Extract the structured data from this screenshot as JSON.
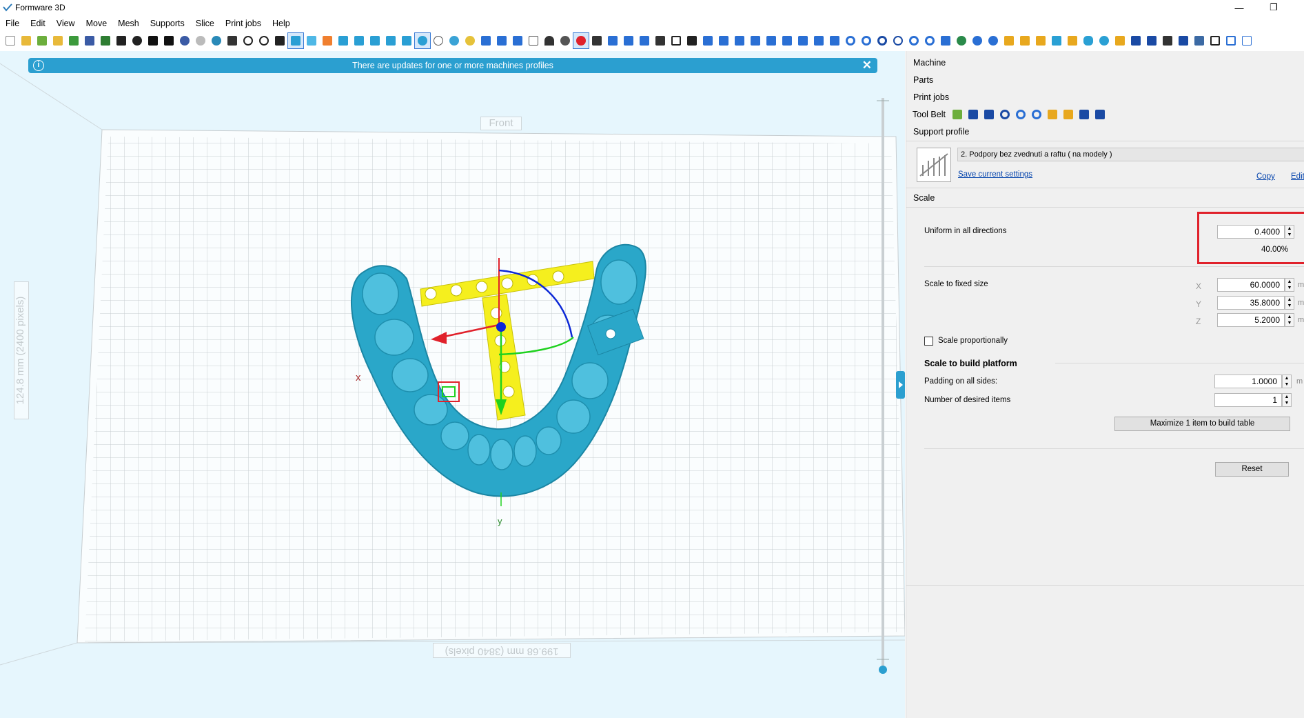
{
  "window": {
    "title": "Formware 3D",
    "minimize": "—",
    "restore": "❐"
  },
  "menu": [
    "File",
    "Edit",
    "View",
    "Move",
    "Mesh",
    "Supports",
    "Slice",
    "Print jobs",
    "Help"
  ],
  "banner": {
    "text": "There are updates for one or more machines profiles",
    "info": "i",
    "close": "✕"
  },
  "viewport": {
    "front_label": "Front",
    "x_dim": "199.68 mm (3840 pixels)",
    "y_dim": "124.8 mm (2400 pixels)",
    "x_axis": "x",
    "y_axis": "y"
  },
  "panel": {
    "sections": {
      "machine": "Machine",
      "parts": "Parts",
      "print_jobs": "Print jobs",
      "tool_belt": "Tool Belt",
      "support_profile": "Support profile",
      "scale": "Scale"
    },
    "support_profile": {
      "name": "2. Podpory bez zvednuti a raftu ( na modely )",
      "save": "Save current settings",
      "copy": "Copy",
      "edit": "Edit"
    },
    "scale": {
      "uniform_label": "Uniform in all directions",
      "uniform_value": "0.4000",
      "uniform_percent": "40.00%",
      "fixed_label": "Scale to fixed size",
      "x_label": "X",
      "x_value": "60.0000",
      "y_label": "Y",
      "y_value": "35.8000",
      "z_label": "Z",
      "z_value": "5.2000",
      "unit": "m",
      "proportional_label": "Scale proportionally",
      "build_platform_label": "Scale to build platform",
      "padding_label": "Padding on all sides:",
      "padding_value": "1.0000",
      "items_label": "Number of desired items",
      "items_value": "1",
      "maximize_label": "Maximize 1 item to build table",
      "reset_label": "Reset"
    }
  },
  "colors": {
    "accent": "#2b9fd0",
    "model": "#2aa7c9",
    "support": "#f5ef1e",
    "highlight": "#e0212b"
  }
}
